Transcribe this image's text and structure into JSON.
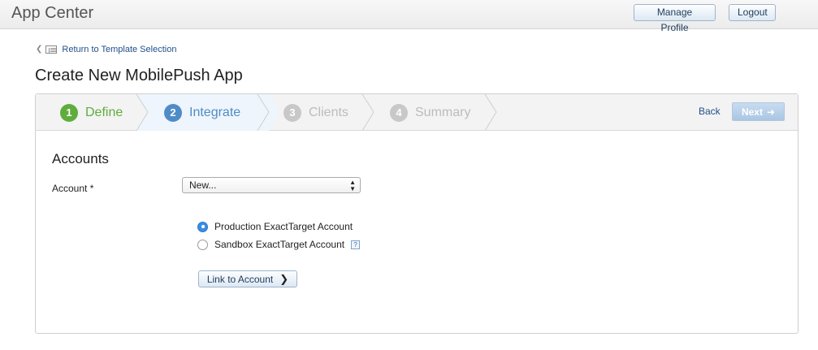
{
  "header": {
    "app_title": "App Center",
    "manage_profile_label": "Manage Profile",
    "logout_label": "Logout"
  },
  "breadcrumb": {
    "back_label": "Return to Template Selection"
  },
  "page": {
    "title": "Create New MobilePush App"
  },
  "wizard": {
    "steps": [
      {
        "number": "1",
        "label": "Define",
        "state": "complete"
      },
      {
        "number": "2",
        "label": "Integrate",
        "state": "active"
      },
      {
        "number": "3",
        "label": "Clients",
        "state": "disabled"
      },
      {
        "number": "4",
        "label": "Summary",
        "state": "disabled"
      }
    ],
    "back_label": "Back",
    "next_label": "Next"
  },
  "accounts": {
    "section_title": "Accounts",
    "account_label": "Account *",
    "account_selected": "New...",
    "radio_options": [
      {
        "label": "Production ExactTarget Account",
        "checked": true
      },
      {
        "label": "Sandbox ExactTarget Account",
        "checked": false
      }
    ],
    "help_glyph": "?",
    "link_button_label": "Link to Account"
  },
  "colors": {
    "step_complete": "#5fad3b",
    "step_active": "#4f8cc7",
    "step_disabled": "#c8c8c8",
    "link": "#1f4f8a",
    "radio_checked": "#3a8ee6"
  }
}
